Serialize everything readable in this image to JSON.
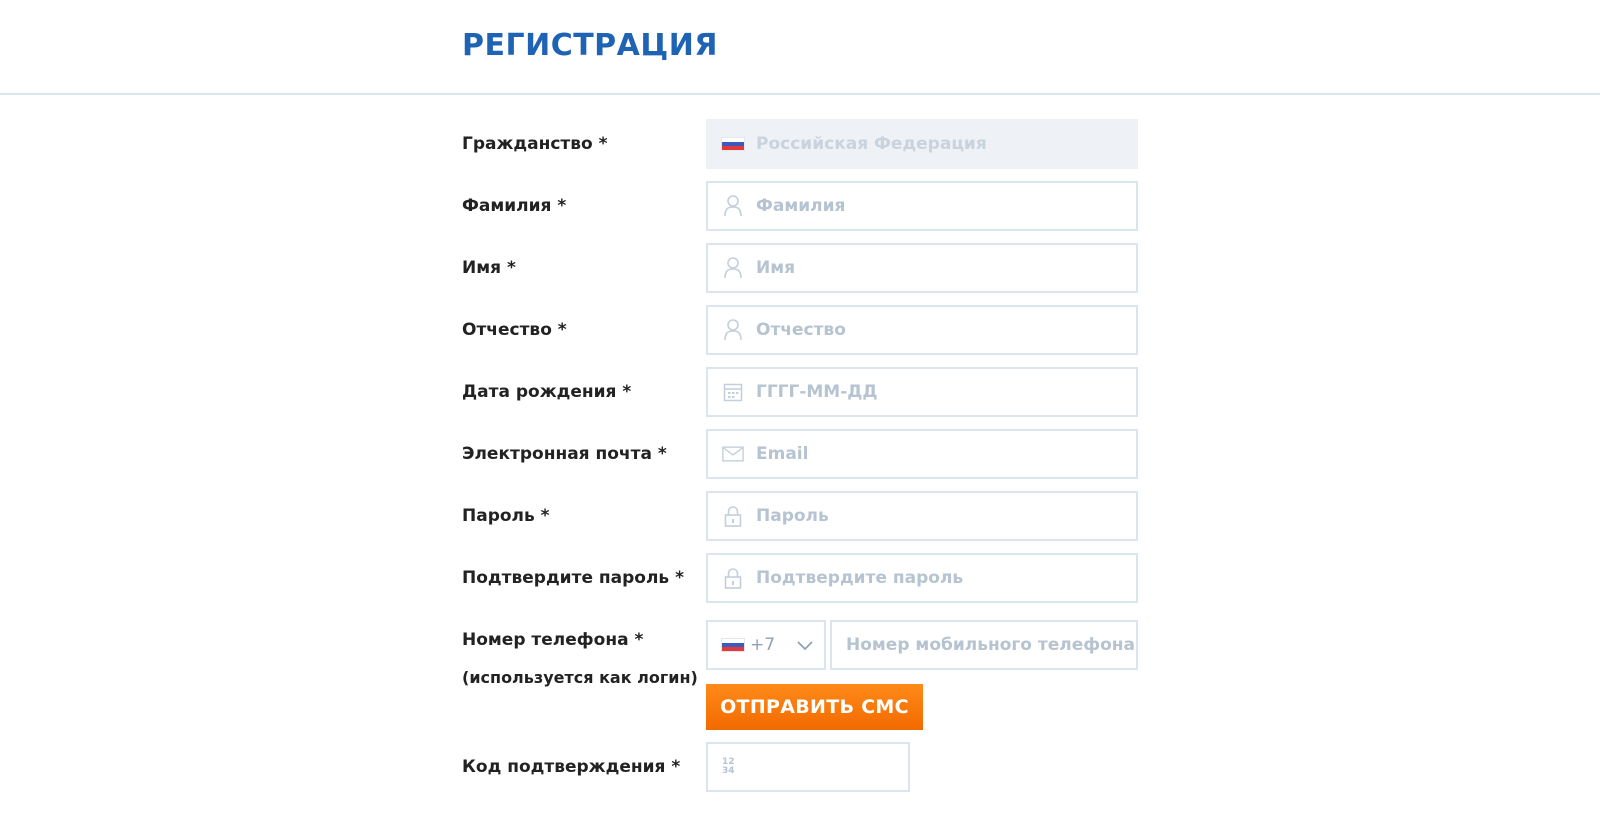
{
  "page": {
    "title": "РЕГИСТРАЦИЯ"
  },
  "form": {
    "citizenship": {
      "label": "Гражданство *",
      "value": "Российская Федерация",
      "icon": "flag-ru-icon"
    },
    "last_name": {
      "label": "Фамилия *",
      "placeholder": "Фамилия",
      "icon": "user-icon"
    },
    "first_name": {
      "label": "Имя *",
      "placeholder": "Имя",
      "icon": "user-icon"
    },
    "patronymic": {
      "label": "Отчество *",
      "placeholder": "Отчество",
      "icon": "user-icon"
    },
    "birth_date": {
      "label": "Дата рождения *",
      "placeholder": "ГГГГ-ММ-ДД",
      "icon": "calendar-icon"
    },
    "email": {
      "label": "Электронная почта *",
      "placeholder": "Email",
      "icon": "envelope-icon"
    },
    "password": {
      "label": "Пароль *",
      "placeholder": "Пароль",
      "icon": "lock-icon"
    },
    "password_confirm": {
      "label": "Подтвердите пароль *",
      "placeholder": "Подтвердите пароль",
      "icon": "lock-icon"
    },
    "phone": {
      "label": "Номер телефона *",
      "sublabel": "(используется как логин)",
      "country_code": "+7",
      "placeholder": "Номер мобильного телефона"
    },
    "send_sms_button": "ОТПРАВИТЬ СМС",
    "confirm_code": {
      "label": "Код подтверждения *",
      "icon_top": "12",
      "icon_bottom": "34"
    }
  },
  "colors": {
    "title": "#1f63b4",
    "accent_button": "#f57a0a",
    "border": "#dbe5ef",
    "placeholder": "#b6c3d1"
  }
}
